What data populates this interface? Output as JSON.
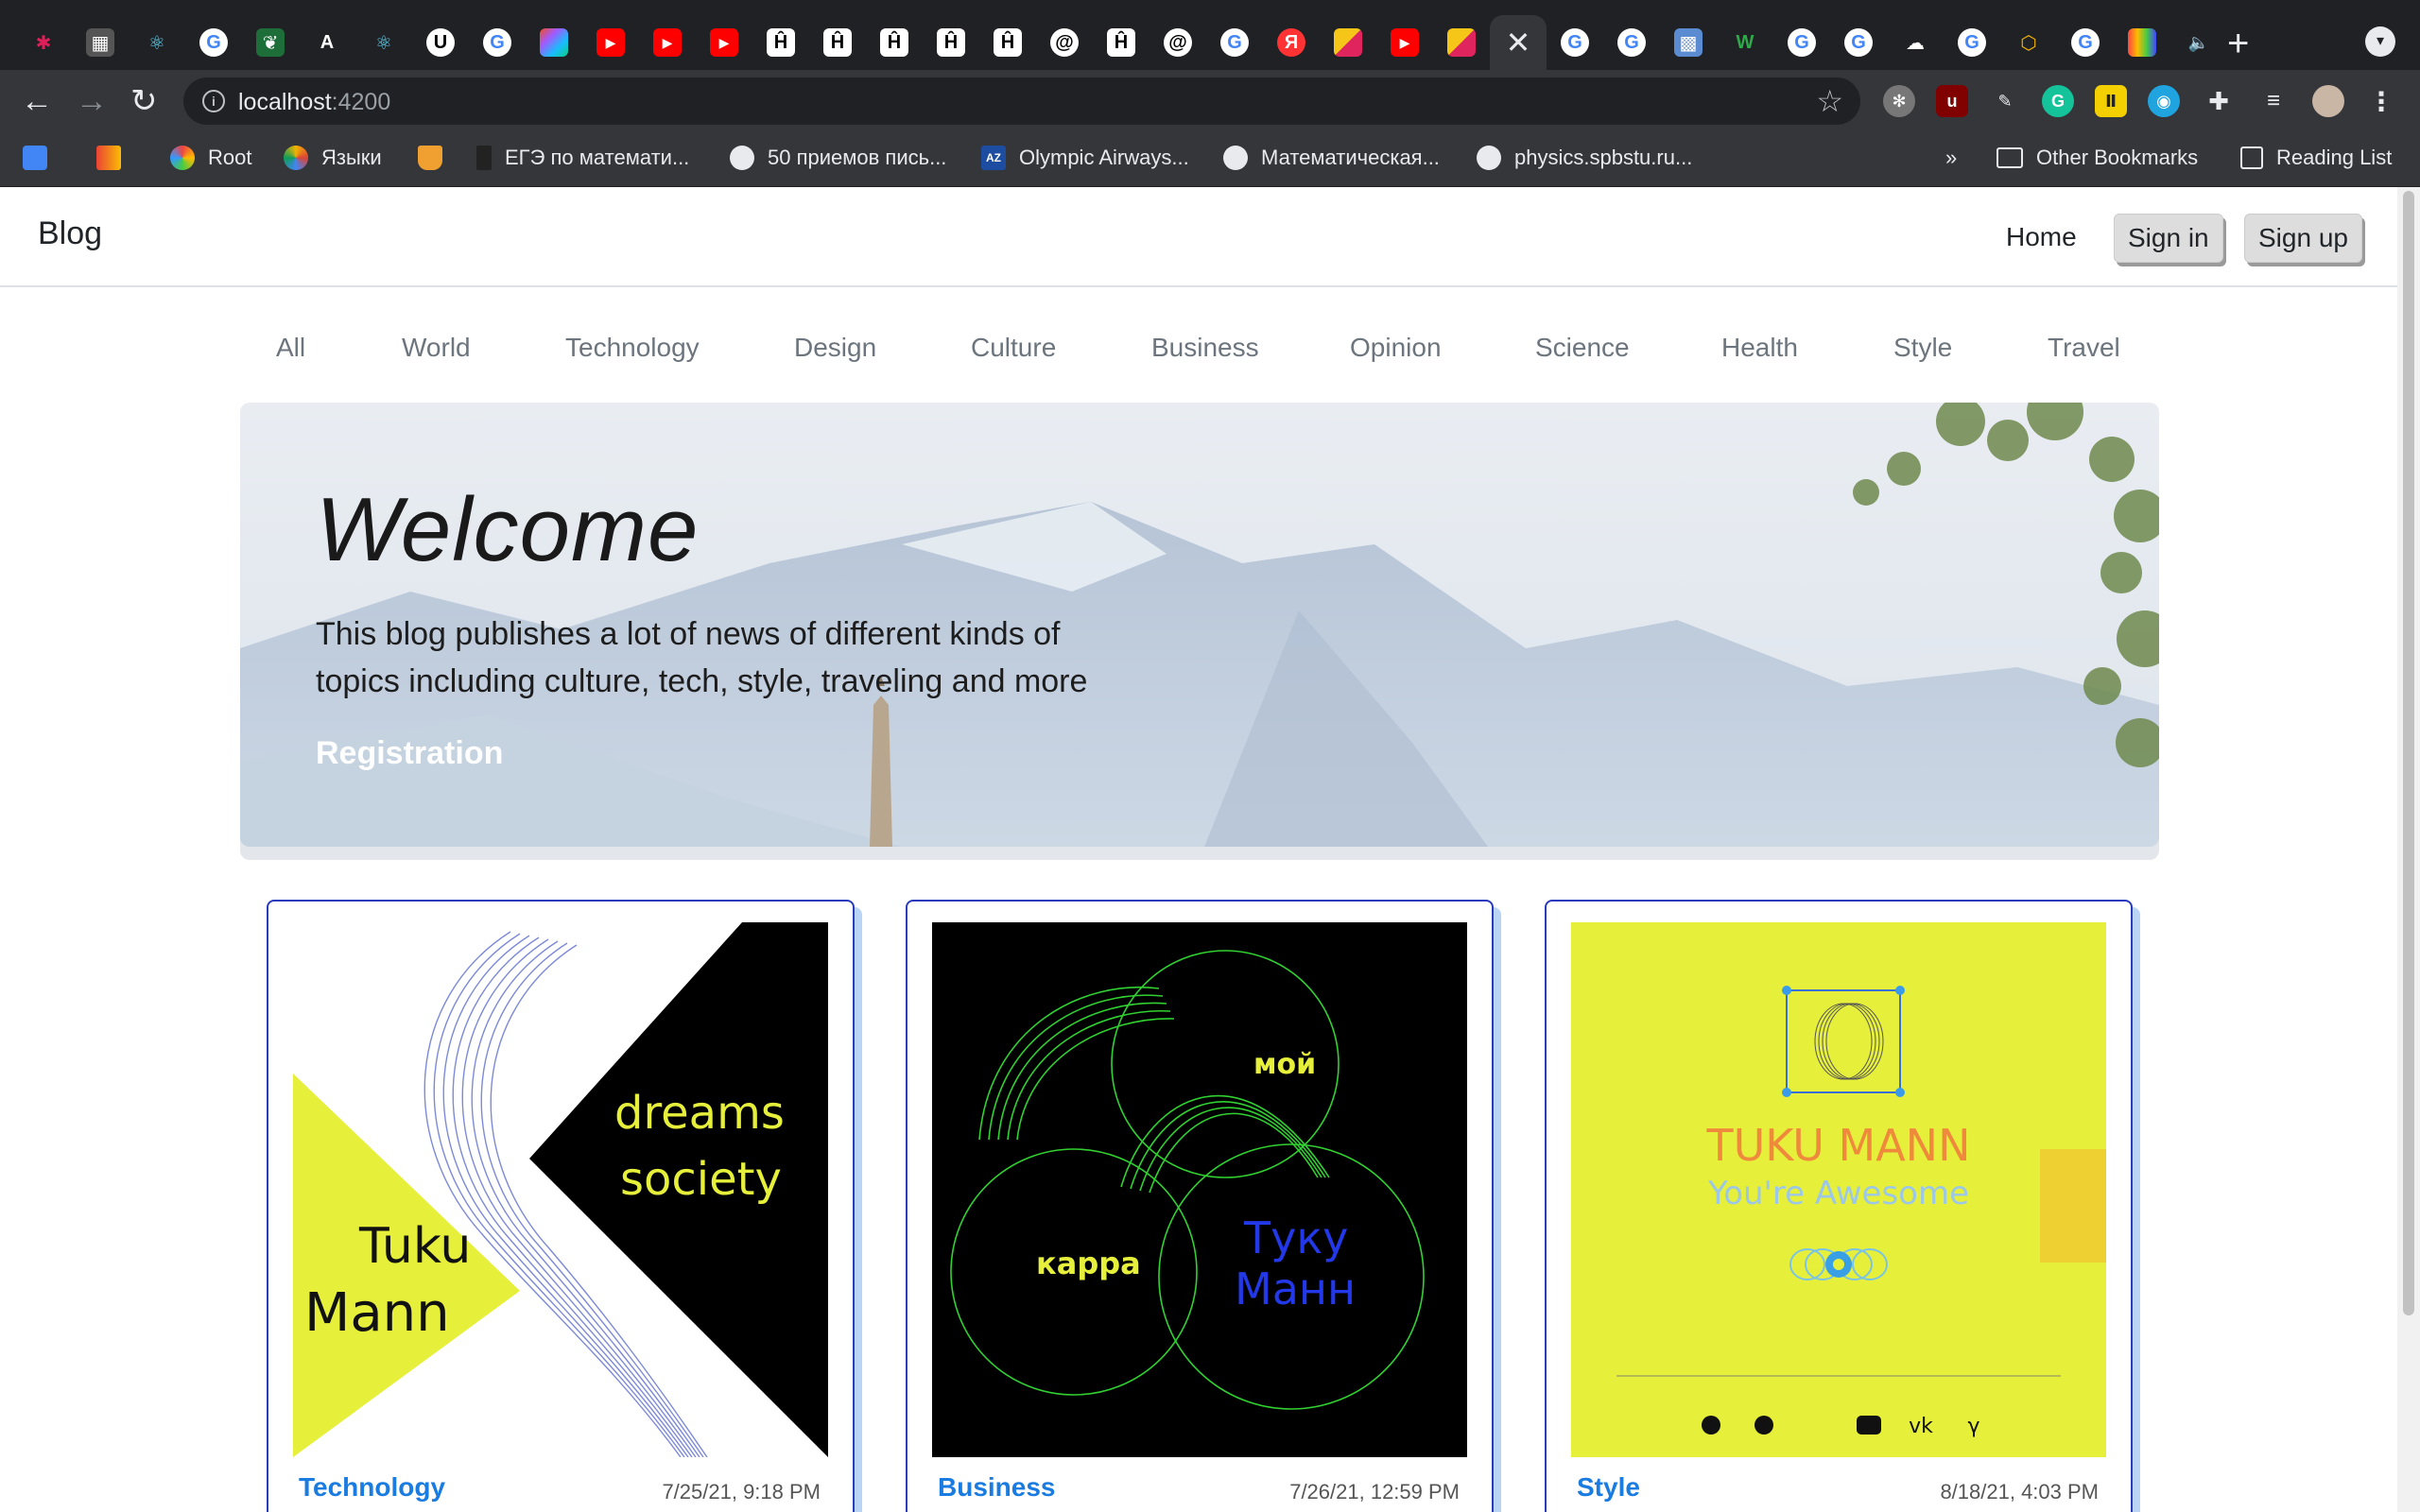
{
  "browser": {
    "url_host": "localhost",
    "url_port": ":4200",
    "bookmarks": [
      {
        "label": ""
      },
      {
        "label": ""
      },
      {
        "label": "Root"
      },
      {
        "label": "Языки"
      },
      {
        "label": ""
      },
      {
        "label": "ЕГЭ по математи..."
      },
      {
        "label": "50 приемов пись..."
      },
      {
        "label": "Olympic Airways..."
      },
      {
        "label": "Математическая..."
      },
      {
        "label": "physics.spbstu.ru..."
      }
    ],
    "bookmarks_overflow": "»",
    "other_bookmarks": "Other Bookmarks",
    "reading_list": "Reading List"
  },
  "site": {
    "brand": "Blog",
    "nav": {
      "home": "Home",
      "sign_in": "Sign in",
      "sign_up": "Sign up"
    },
    "categories": [
      "All",
      "World",
      "Technology",
      "Design",
      "Culture",
      "Business",
      "Opinion",
      "Science",
      "Health",
      "Style",
      "Travel"
    ]
  },
  "hero": {
    "title": "Welcome",
    "text": "This blog publishes a lot of news of different kinds of topics including culture, tech, style, traveling and more",
    "link": "Registration"
  },
  "cards": [
    {
      "category": "Technology",
      "date": "7/25/21, 9:18 PM",
      "art": {
        "word1": "Tuku",
        "word2": "Mann",
        "word3": "dreams",
        "word4": "society"
      }
    },
    {
      "category": "Business",
      "date": "7/26/21, 12:59 PM",
      "art": {
        "word1": "мой",
        "word2": "карра",
        "word3": "Туку",
        "word4": "Манн"
      }
    },
    {
      "category": "Style",
      "date": "8/18/21, 4:03 PM",
      "art": {
        "title": "TUKU MANN",
        "subtitle": "You're Awesome"
      }
    }
  ],
  "colors": {
    "accent_blue": "#1a7be0",
    "card_border": "#2b3bbd",
    "lime": "#e6f03a"
  }
}
